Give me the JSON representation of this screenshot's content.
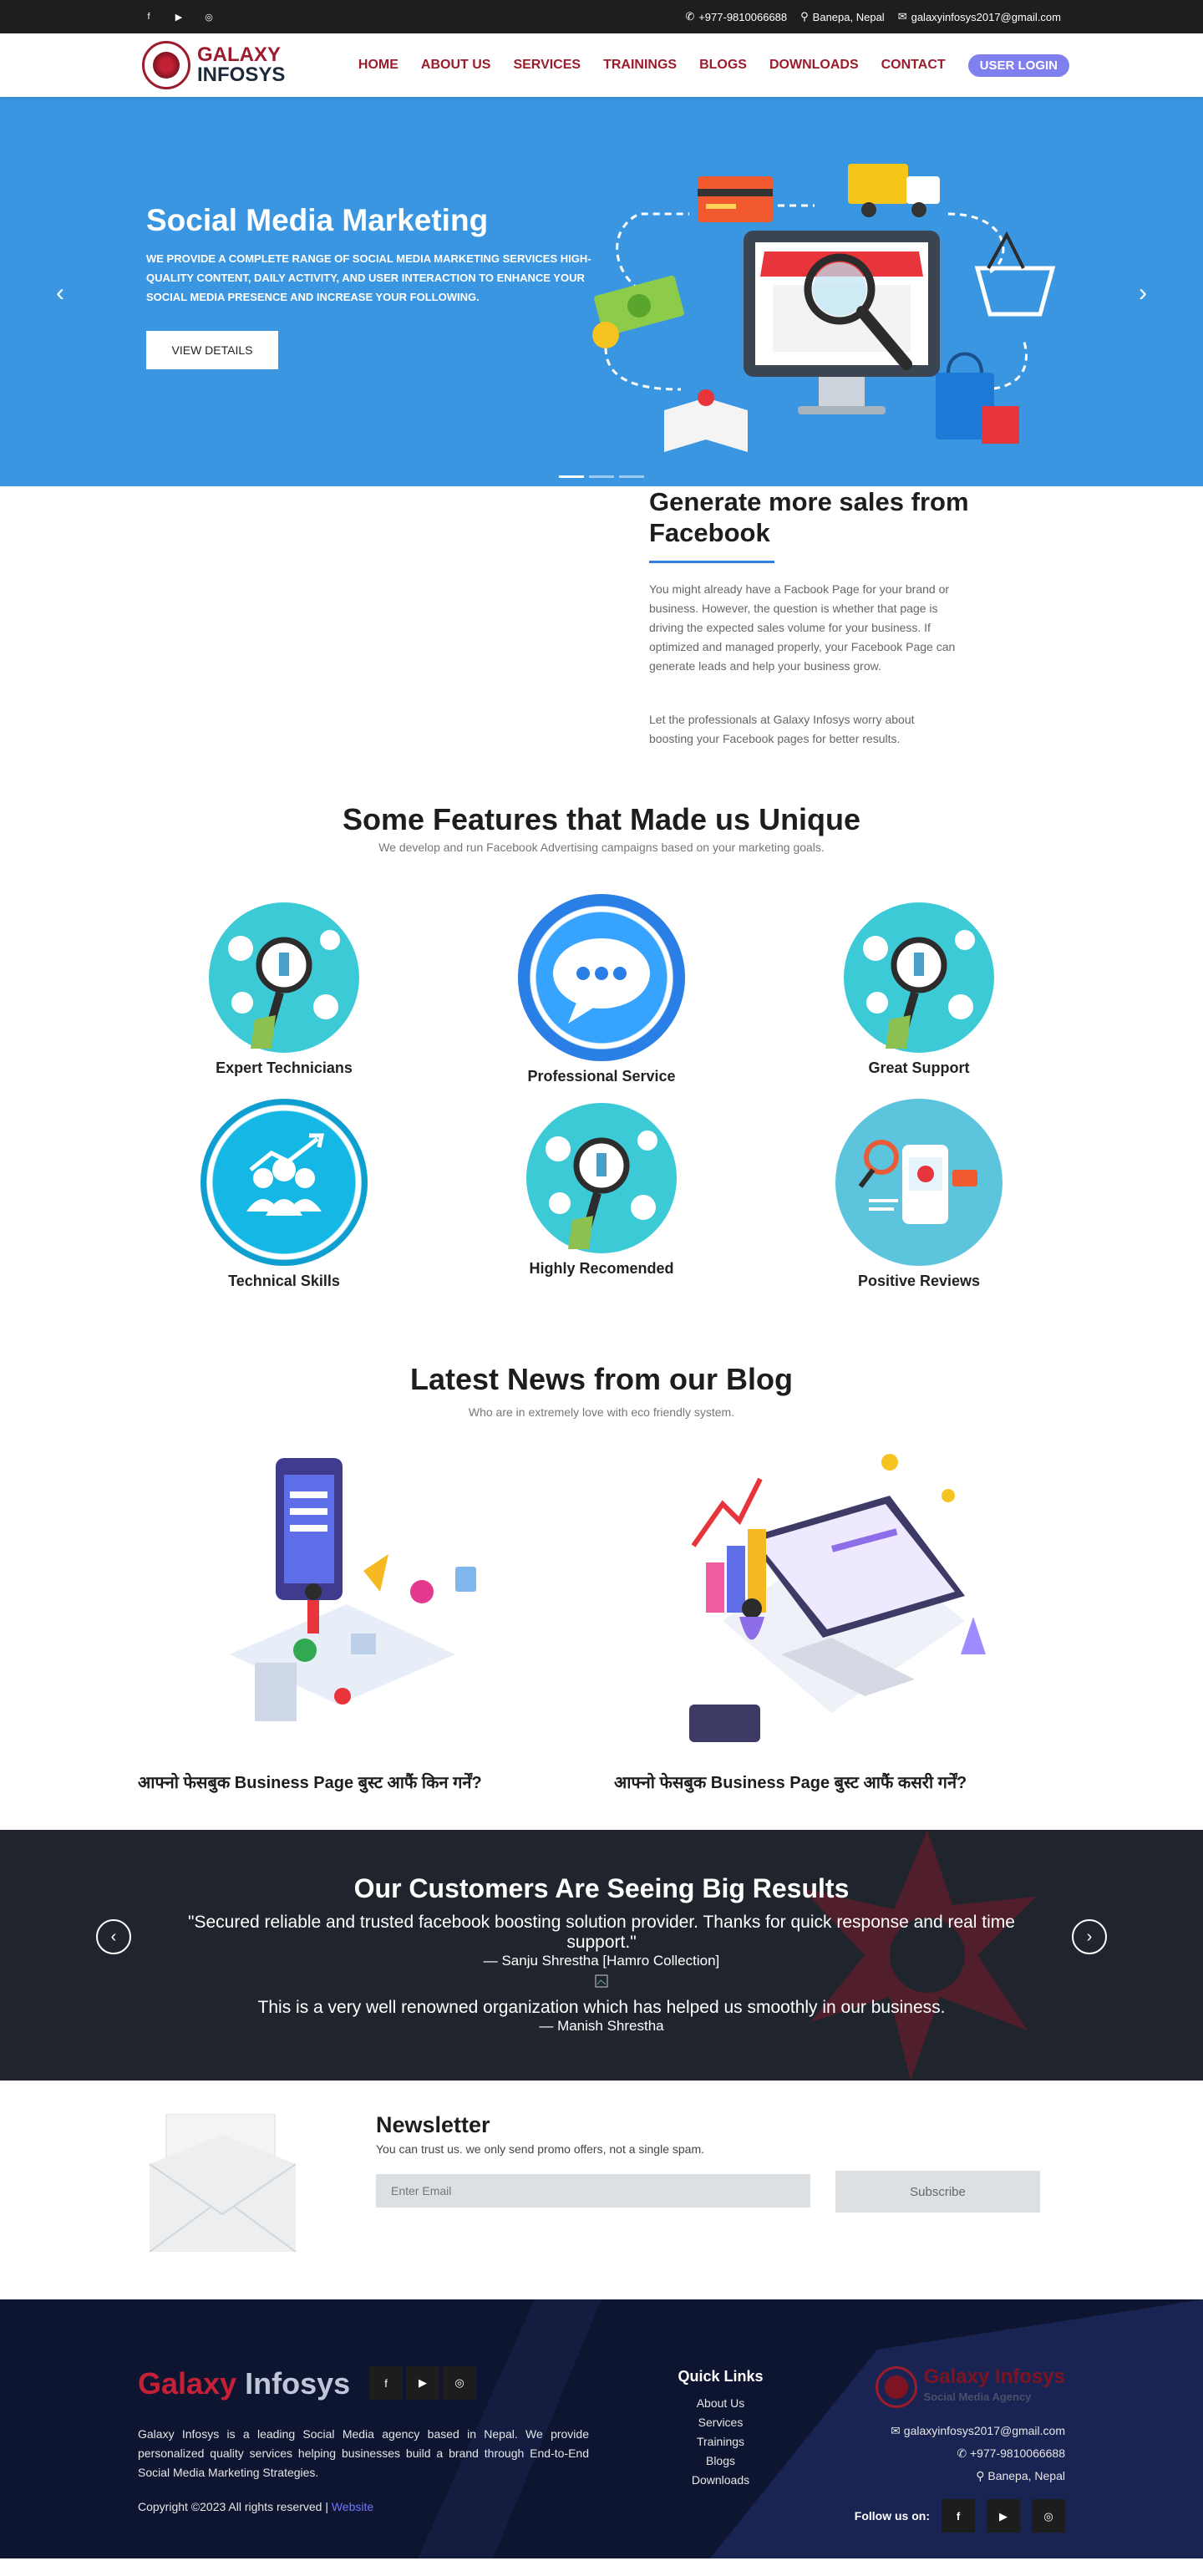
{
  "topbar": {
    "social": [
      "f",
      "▶",
      "◎"
    ],
    "phone": "+977-9810066688",
    "location": "Banepa, Nepal",
    "email": "galaxyinfosys2017@gmail.com"
  },
  "header": {
    "logo_line1": "GALAXY",
    "logo_line2": "INFOSYS",
    "nav": [
      "HOME",
      "ABOUT US",
      "SERVICES",
      "TRAININGS",
      "BLOGS",
      "DOWNLOADS",
      "CONTACT"
    ],
    "login": "USER LOGIN"
  },
  "hero": {
    "title": "Social Media Marketing",
    "text": "WE PROVIDE A COMPLETE RANGE OF SOCIAL MEDIA MARKETING SERVICES HIGH-QUALITY CONTENT, DAILY ACTIVITY, AND USER INTERACTION TO ENHANCE YOUR SOCIAL MEDIA PRESENCE AND INCREASE YOUR FOLLOWING.",
    "button": "VIEW DETAILS",
    "prev": "‹",
    "next": "›"
  },
  "facebook": {
    "title": "Generate more sales from Facebook",
    "p1": "You might already have a Facbook Page for your brand or business. However, the question is whether that page is driving the expected sales volume for your business. If optimized and managed properly, your Facebook Page can generate leads and help your business grow.",
    "p2": "Let the professionals at Galaxy Infosys worry about boosting your Facebook pages for better results."
  },
  "features": {
    "title": "Some Features that Made us Unique",
    "subtitle": "We develop and run Facebook Advertising campaigns based on your marketing goals.",
    "items": [
      {
        "name": "Expert Technicians",
        "icon": "magnifier-people-icon"
      },
      {
        "name": "Professional Service",
        "icon": "chat-bubble-icon"
      },
      {
        "name": "Great Support",
        "icon": "magnifier-people-icon"
      },
      {
        "name": "Technical Skills",
        "icon": "growth-team-icon"
      },
      {
        "name": "Highly Recomended",
        "icon": "magnifier-people-icon"
      },
      {
        "name": "Positive Reviews",
        "icon": "reviews-icon"
      }
    ]
  },
  "blog": {
    "title": "Latest News from our Blog",
    "subtitle": "Who are in extremely love with eco friendly system.",
    "posts": [
      {
        "title": "आफ्नो फेसबुक Business Page बुस्ट आफैं किन गर्नें?"
      },
      {
        "title": "आफ्नो फेसबुक Business Page बुस्ट आफैं कसरी गर्नें?"
      }
    ]
  },
  "testimonials": {
    "title": "Our Customers Are Seeing Big Results",
    "items": [
      {
        "quote": "\"Secured reliable and trusted facebook boosting solution provider. Thanks for quick response and real time support.\"",
        "author": "— Sanju Shrestha [Hamro Collection]"
      },
      {
        "quote": "This is a very well renowned organization which has helped us smoothly in our business.",
        "author": "— Manish Shrestha"
      }
    ]
  },
  "newsletter": {
    "title": "Newsletter",
    "text": "You can trust us. we only send promo offers, not a single spam.",
    "placeholder": "Enter Email",
    "button": "Subscribe"
  },
  "footer": {
    "brand_a": "Galaxy",
    "brand_b": "Infosys",
    "about": "Galaxy Infosys is a leading Social Media agency based in Nepal. We provide personalized quality services helping businesses build a brand through End-to-End Social Media Marketing Strategies.",
    "copyright": "Copyright ©2023 All rights reserved |",
    "copyright_link": "Website",
    "quick_title": "Quick Links",
    "links": [
      "About Us",
      "Services",
      "Trainings",
      "Blogs",
      "Downloads"
    ],
    "logo_a": "Galaxy",
    "logo_b": "Infosys",
    "logo_tag": "Social Media Agency",
    "email": "galaxyinfosys2017@gmail.com",
    "phone": "+977-9810066688",
    "location": "Banepa, Nepal",
    "follow": "Follow us on:"
  }
}
